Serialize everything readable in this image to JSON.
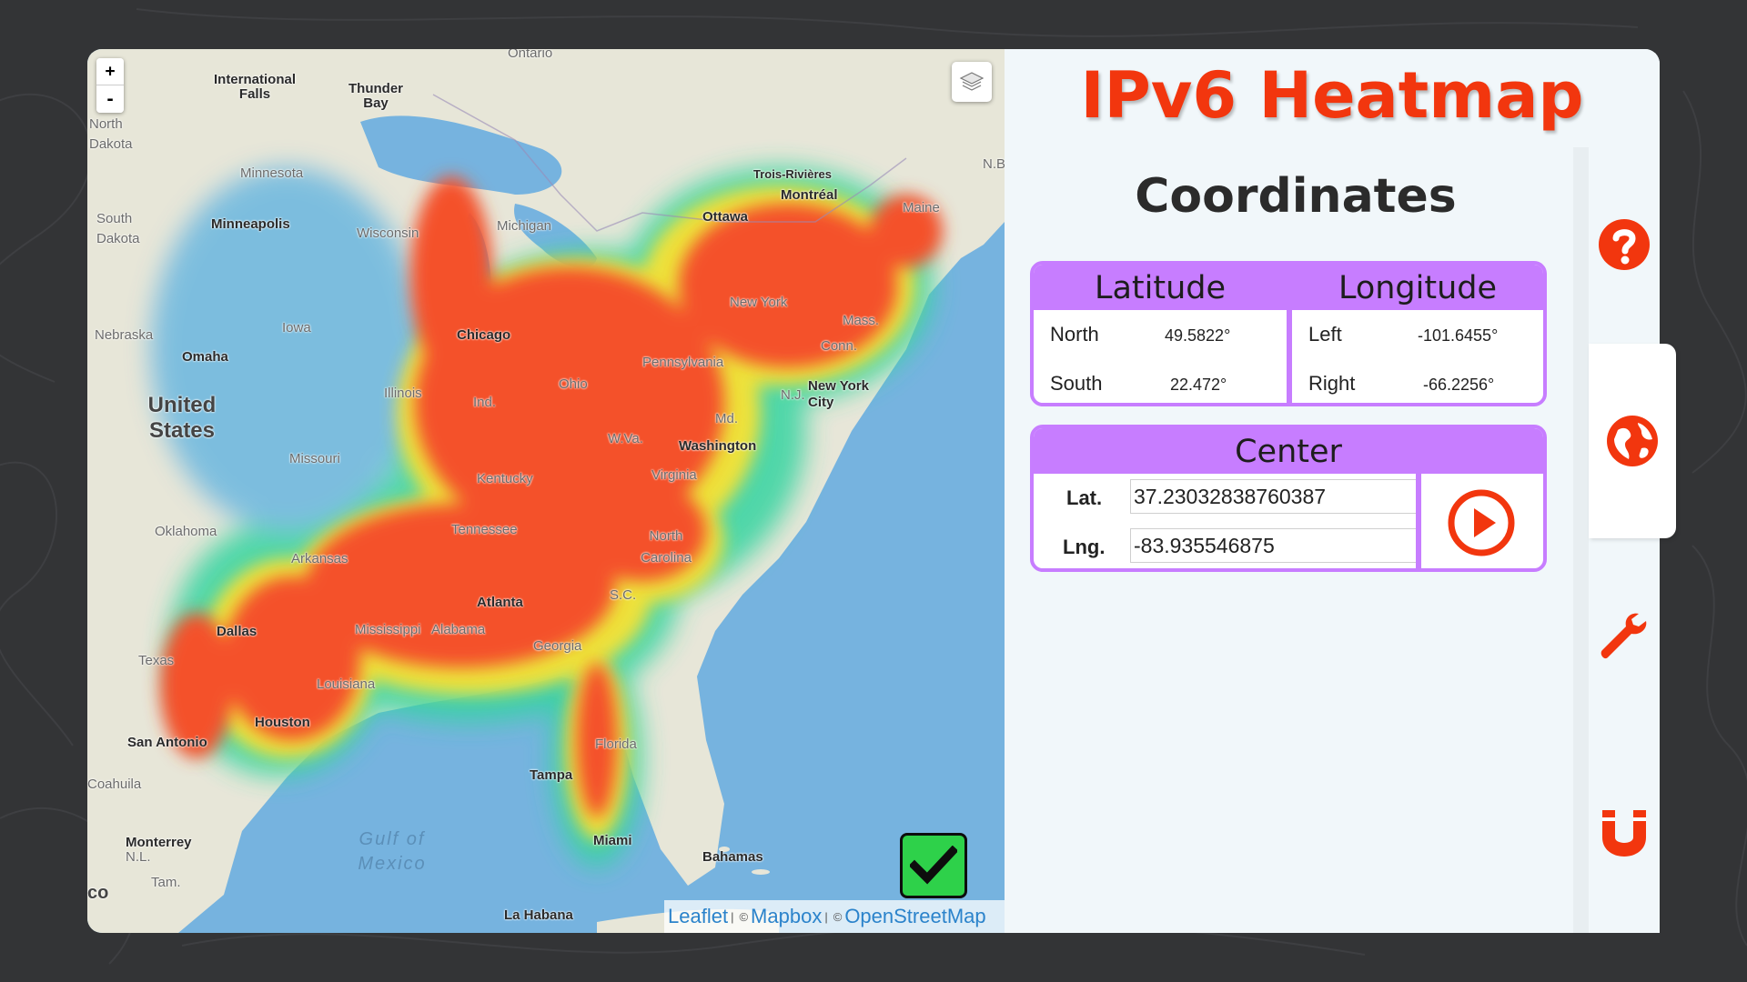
{
  "app": {
    "title": "IPv6 Heatmap",
    "accent_color": "#f2360e",
    "panel_color": "#c77dff"
  },
  "map": {
    "zoom_in": "+",
    "zoom_out": "-",
    "labels": {
      "ontario": "Ontario",
      "international_falls": "International Falls",
      "thunder_bay": "Thunder Bay",
      "north_dakota": "North Dakota",
      "minnesota": "Minnesota",
      "south_dakota": "South Dakota",
      "minneapolis": "Minneapolis",
      "wisconsin": "Wisconsin",
      "michigan": "Michigan",
      "trois_rivieres": "Trois-Rivières",
      "montreal": "Montréal",
      "ottawa": "Ottawa",
      "maine": "Maine",
      "nb": "N.B.",
      "new_york_state": "New York",
      "mass": "Mass.",
      "conn": "Conn.",
      "nebraska": "Nebraska",
      "omaha": "Omaha",
      "iowa": "Iowa",
      "chicago": "Chicago",
      "illinois": "Illinois",
      "ind": "Ind.",
      "ohio": "Ohio",
      "pennsylvania": "Pennsylvania",
      "nj": "N.J.",
      "new_york_city": "New York City",
      "md": "Md.",
      "united_states": "United States",
      "missouri": "Missouri",
      "wva": "W.Va.",
      "washington": "Washington",
      "kentucky": "Kentucky",
      "virginia": "Virginia",
      "oklahoma": "Oklahoma",
      "tennessee": "Tennessee",
      "north_carolina": "North Carolina",
      "arkansas": "Arkansas",
      "atlanta": "Atlanta",
      "sc": "S.C.",
      "dallas": "Dallas",
      "mississippi": "Mississippi",
      "alabama": "Alabama",
      "georgia": "Georgia",
      "texas": "Texas",
      "louisiana": "Louisiana",
      "san_antonio": "San Antonio",
      "houston": "Houston",
      "florida": "Florida",
      "tampa": "Tampa",
      "coahuila": "Coahuila",
      "monterrey": "Monterrey",
      "nl": "N.L.",
      "gulf_of_mexico": "Gulf of Mexico",
      "miami": "Miami",
      "bahamas": "Bahamas",
      "tam": "Tam.",
      "la_habana": "La Habana",
      "mexico_edge": "co"
    },
    "attribution": {
      "leaflet": "Leaflet",
      "mapbox": "Mapbox",
      "osm": "OpenStreetMap",
      "sep": "|",
      "copy": "©"
    }
  },
  "panel": {
    "section_title": "Coordinates",
    "latitude": {
      "header": "Latitude",
      "north_label": "North",
      "north_value": "49.5822°",
      "south_label": "South",
      "south_value": "22.472°"
    },
    "longitude": {
      "header": "Longitude",
      "left_label": "Left",
      "left_value": "-101.6455°",
      "right_label": "Right",
      "right_value": "-66.2256°"
    },
    "center": {
      "header": "Center",
      "lat_label": "Lat.",
      "lat_value": "37.23032838760387",
      "lng_label": "Lng.",
      "lng_value": "-83.935546875"
    }
  },
  "tabs": [
    {
      "icon": "help-icon"
    },
    {
      "icon": "globe-icon",
      "active": true
    },
    {
      "icon": "wrench-icon"
    },
    {
      "icon": "magnet-icon"
    }
  ]
}
